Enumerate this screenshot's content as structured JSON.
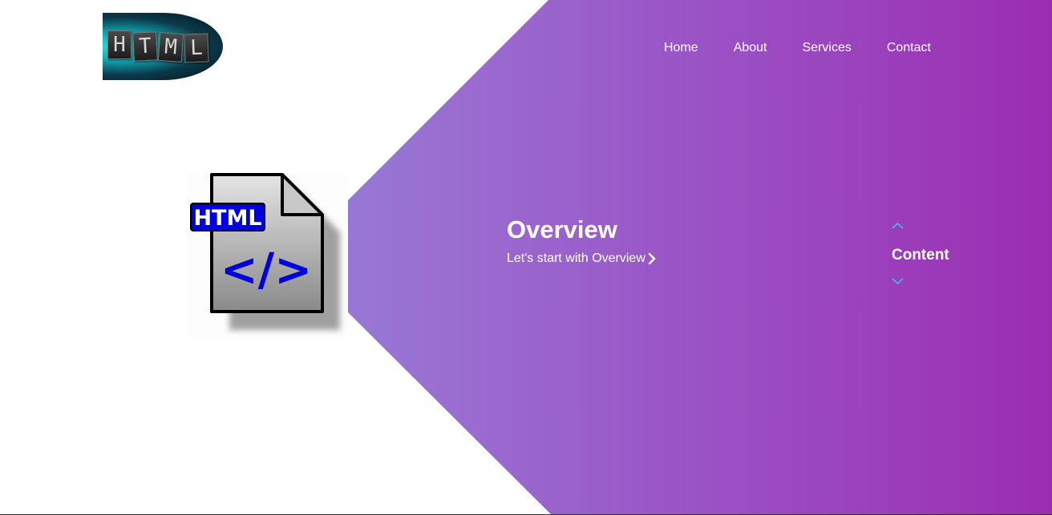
{
  "logo": {
    "letters": [
      "H",
      "T",
      "M",
      "L"
    ]
  },
  "nav": {
    "items": [
      {
        "label": "Home"
      },
      {
        "label": "About"
      },
      {
        "label": "Services"
      },
      {
        "label": "Contact"
      }
    ]
  },
  "hero": {
    "file_icon_badge": "HTML",
    "file_icon_code": "</>",
    "title": "Overview",
    "link_text": "Let's start with Overview"
  },
  "switcher": {
    "label": "Content",
    "up_icon": "chevron-up-icon",
    "down_icon": "chevron-down-icon"
  },
  "colors": {
    "gradient_start": "#8e9be3",
    "gradient_mid": "#9a6bd0",
    "gradient_end": "#9b2db3",
    "chevron_accent": "#4fb4e8",
    "badge_blue": "#0000dd"
  }
}
